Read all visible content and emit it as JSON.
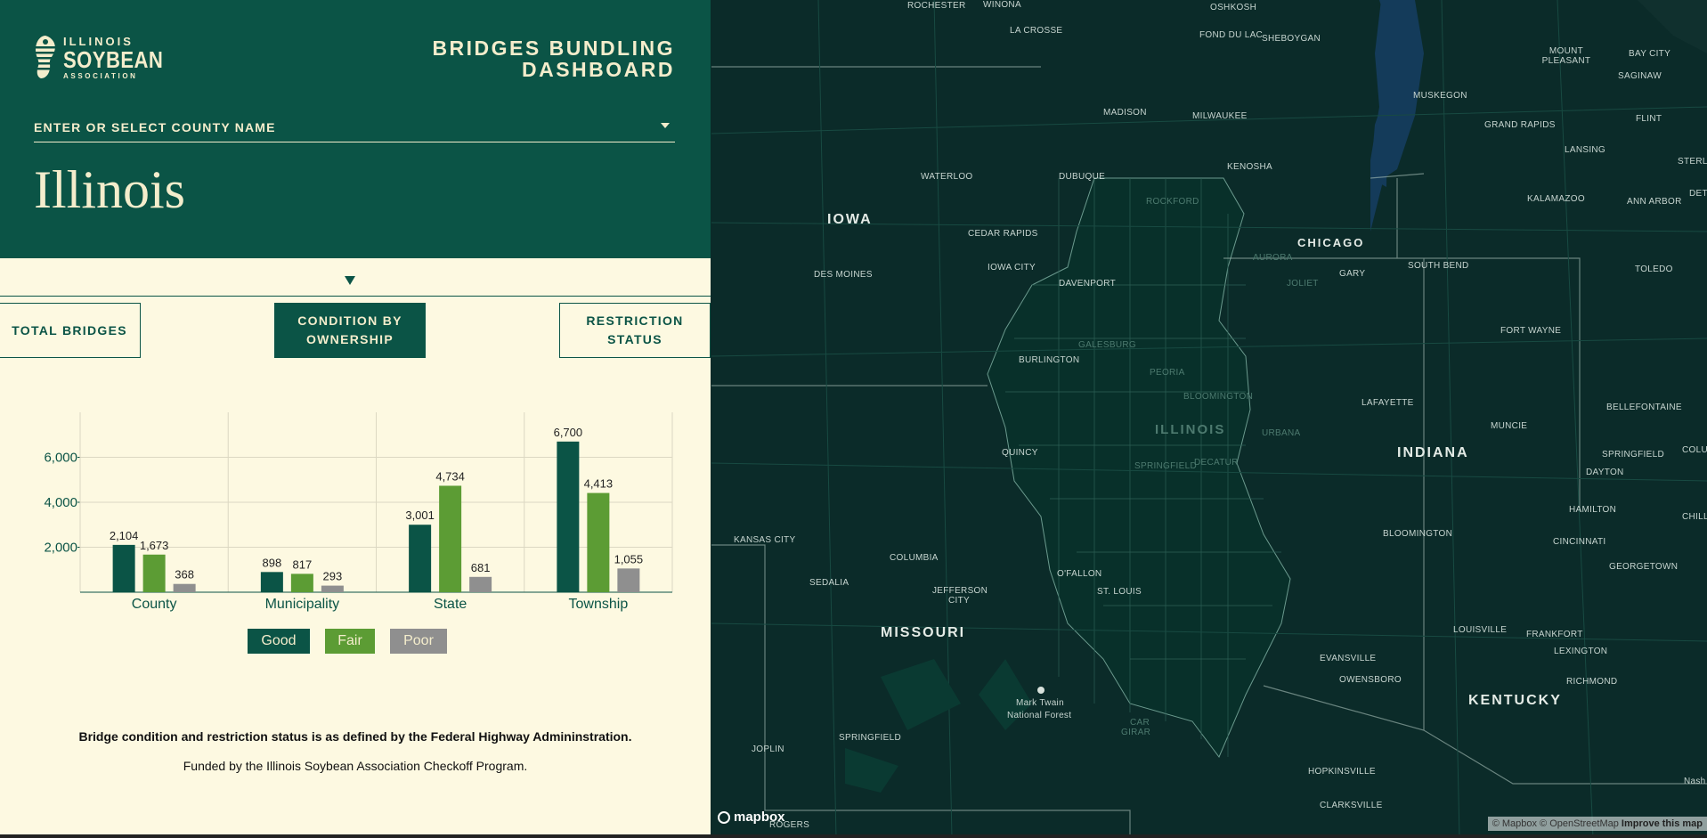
{
  "header": {
    "logo": {
      "line1": "ILLINOIS",
      "line2": "SOYBEAN",
      "line3": "ASSOCIATION"
    },
    "title_line1": "BRIDGES BUNDLING",
    "title_line2": "DASHBOARD",
    "county_placeholder": "ENTER OR SELECT COUNTY NAME",
    "place_name": "Illinois"
  },
  "tabs": [
    {
      "label": "TOTAL BRIDGES",
      "active": false
    },
    {
      "label": "CONDITION BY OWNERSHIP",
      "active": true
    },
    {
      "label": "RESTRICTION STATUS",
      "active": false
    }
  ],
  "chart_data": {
    "type": "bar",
    "categories": [
      "County",
      "Municipality",
      "State",
      "Township"
    ],
    "series": [
      {
        "name": "Good",
        "color": "#0b5446",
        "values": [
          2104,
          898,
          3001,
          6700
        ]
      },
      {
        "name": "Fair",
        "color": "#5c9c34",
        "values": [
          1673,
          817,
          4734,
          4413
        ]
      },
      {
        "name": "Poor",
        "color": "#8f8f8f",
        "values": [
          368,
          293,
          681,
          1055
        ]
      }
    ],
    "data_labels": [
      [
        "2,104",
        "898",
        "3,001",
        "6,700"
      ],
      [
        "1,673",
        "817",
        "4,734",
        "4,413"
      ],
      [
        "368",
        "293",
        "681",
        "1,055"
      ]
    ],
    "y_ticks": [
      2000,
      4000,
      6000
    ],
    "y_tick_labels": [
      "2,000",
      "4,000",
      "6,000"
    ],
    "ylim": [
      0,
      8000
    ],
    "grid": true,
    "legend_placement": "bottom"
  },
  "legend": {
    "good": "Good",
    "fair": "Fair",
    "poor": "Poor"
  },
  "footer": {
    "note": "Bridge condition and restriction status is as defined by the Federal Highway Admininstration.",
    "funding": "Funded by the Illinois Soybean Association Checkoff Program."
  },
  "map": {
    "states": {
      "iowa": "IOWA",
      "missouri": "MISSOURI",
      "indiana": "INDIANA",
      "kentucky": "KENTUCKY",
      "illinois": "ILLINOIS",
      "chicago": "CHICAGO"
    },
    "cities": {
      "rochester": "ROCHESTER",
      "winona": "WINONA",
      "la_crosse": "LA CROSSE",
      "oshkosh": "OSHKOSH",
      "fond_du_lac": "FOND DU LAC",
      "sheboygan": "SHEBOYGAN",
      "mount_pleasant": "MOUNT PLEASANT",
      "bay_city": "BAY CITY",
      "saginaw": "SAGINAW",
      "muskegon": "MUSKEGON",
      "flint": "FLINT",
      "grand_rapids": "GRAND RAPIDS",
      "madison": "MADISON",
      "milwaukee": "MILWAUKEE",
      "lansing": "LANSING",
      "kenosha": "KENOSHA",
      "sterling_heights": "STERLING HEIGHTS",
      "detroit": "DETRO",
      "waterloo": "WATERLOO",
      "dubuque": "DUBUQUE",
      "kalamazoo": "KALAMAZOO",
      "ann_arbor": "ANN ARBOR",
      "rockford": "ROCKFORD",
      "cedar_rapids": "CEDAR RAPIDS",
      "iowa_city": "IOWA CITY",
      "aurora": "AURORA",
      "gary": "GARY",
      "south_bend": "SOUTH BEND",
      "toledo": "TOLEDO",
      "des_moines": "DES MOINES",
      "davenport": "DAVENPORT",
      "joliet": "JOLIET",
      "burlington": "BURLINGTON",
      "galesburg": "GALESBURG",
      "fort_wayne": "FORT WAYNE",
      "peoria": "PEORIA",
      "bloomington_il": "BLOOMINGTON",
      "lafayette": "LAFAYETTE",
      "bellefontaine": "BELLEFONTAINE",
      "muncie": "MUNCIE",
      "quincy": "QUINCY",
      "urbana": "URBANA",
      "springfield_il": "SPRINGFIELD",
      "decatur": "DECATUR",
      "springfield_oh": "SPRINGFIELD",
      "columbus_oh": "COLUM",
      "dayton": "DAYTON",
      "hamilton": "HAMILTON",
      "chillicothe": "CHILLIC",
      "kansas_city": "KANSAS CITY",
      "bloomington_in": "BLOOMINGTON",
      "cincinnati": "CINCINNATI",
      "columbia": "COLUMBIA",
      "georgetown": "GEORGETOWN",
      "sedalia": "SEDALIA",
      "jefferson_city": "JEFFERSON CITY",
      "ofallon": "O'FALLON",
      "st_louis": "ST. LOUIS",
      "louisville": "LOUISVILLE",
      "frankfort": "FRANKFORT",
      "lexington": "LEXINGTON",
      "evansville": "EVANSVILLE",
      "owensboro": "OWENSBORO",
      "richmond": "RICHMOND",
      "mark_twain": "Mark Twain",
      "national_forest": "National Forest",
      "carbondale": "CAR",
      "girard": "GIRAR",
      "joplin": "JOPLIN",
      "springfield_mo": "SPRINGFIELD",
      "hopkinsville": "HOPKINSVILLE",
      "clarksville": "CLARKSVILLE",
      "rogers": "ROGERS",
      "nashville": "Nash"
    },
    "attribution": "© Mapbox © OpenStreetMap",
    "improve_link": "Improve this map",
    "mapbox_logo": "mapbox"
  }
}
